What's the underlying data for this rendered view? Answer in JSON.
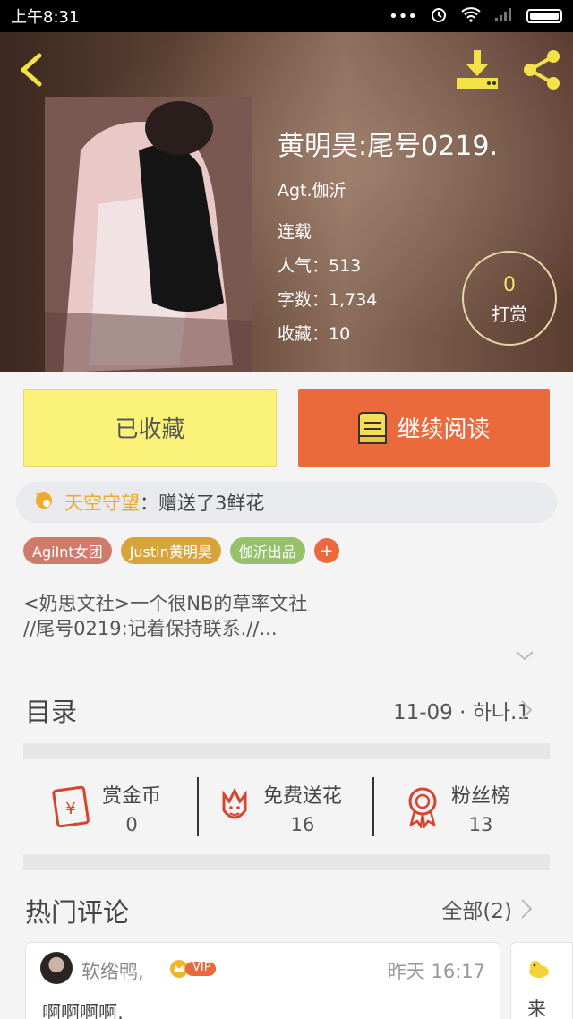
{
  "status_bar": {
    "time": "上午8:31"
  },
  "book": {
    "title": "黄明昊:尾号0219.",
    "author": "Agt.伽沂",
    "status": "连载",
    "popularity": "人气：513",
    "words": "字数：1,734",
    "favorites": "收藏：10",
    "tip_count": "0",
    "tip_label": "打赏"
  },
  "actions": {
    "favorited_label": "已收藏",
    "continue_label": "继续阅读"
  },
  "gift": {
    "user": "天空守望",
    "message": "：赠送了3鲜花"
  },
  "tags": [
    "AgiInt女团",
    "Justin黄明昊",
    "伽沂出品"
  ],
  "tag_add": "+",
  "description": [
    "<奶思文社>一个很NB的草率文社",
    "//尾号0219:记着保持联系.//..."
  ],
  "toc": {
    "title": "目录",
    "latest": "11-09 · 하나.1"
  },
  "stats": [
    {
      "label": "赏金币",
      "value": "0"
    },
    {
      "label": "免费送花",
      "value": "16"
    },
    {
      "label": "粉丝榜",
      "value": "13"
    }
  ],
  "comments": {
    "title": "热门评论",
    "all": "全部(2)",
    "items": [
      {
        "user": "软绺鸭,",
        "badge": "VIP",
        "time": "昨天 16:17",
        "text": "啊啊啊啊,"
      }
    ],
    "partial_text": "来"
  },
  "colors": {
    "read_button": "#ea6a3b",
    "fav_button": "#fbf27a",
    "gift_user": "#f2a92b"
  }
}
